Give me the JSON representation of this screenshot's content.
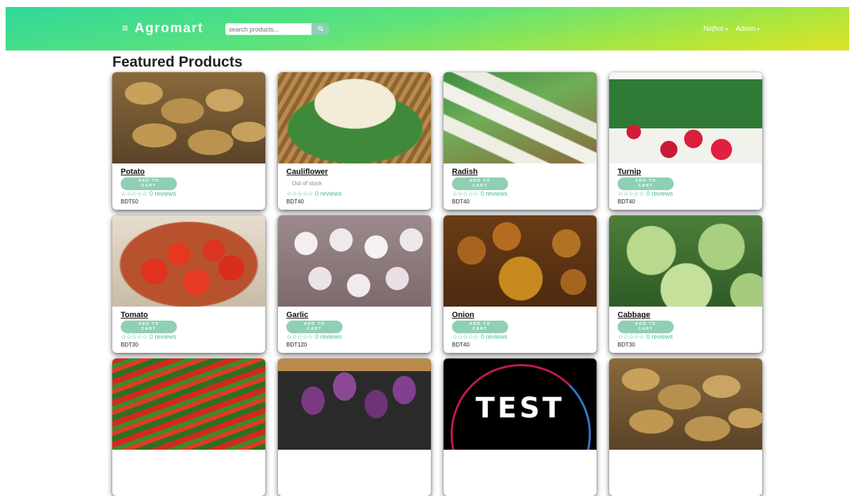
{
  "navbar": {
    "menu_icon": "≡",
    "brand": "Agromart",
    "search_placeholder": "search products...",
    "search_icon": "🔍",
    "user_menu": "Nirjhor",
    "admin_menu": "Admin",
    "caret": "▾"
  },
  "page": {
    "title": "Featured Products"
  },
  "products": [
    {
      "name": "Potato",
      "action": "ADD TO CART",
      "rating": "☆☆☆☆☆",
      "reviews": "0 reviews",
      "price": "BDT50"
    },
    {
      "name": "Cauliflower",
      "action": "Out of stock",
      "rating": "☆☆☆☆☆",
      "reviews": "0 reviews",
      "price": "BDT40"
    },
    {
      "name": "Radish",
      "action": "ADD TO CART",
      "rating": "☆☆☆☆☆",
      "reviews": "0 reviews",
      "price": "BDT40"
    },
    {
      "name": "Turnip",
      "action": "ADD TO CART",
      "rating": "☆☆☆☆☆",
      "reviews": "0 reviews",
      "price": "BDT40"
    },
    {
      "name": "Tomato",
      "action": "ADD TO CART",
      "rating": "☆☆☆☆☆",
      "reviews": "0 reviews",
      "price": "BDT30"
    },
    {
      "name": "Garlic",
      "action": "ADD TO CART",
      "rating": "☆☆☆☆☆",
      "reviews": "0 reviews",
      "price": "BDT120"
    },
    {
      "name": "Onion",
      "action": "ADD TO CART",
      "rating": "☆☆☆☆☆",
      "reviews": "0 reviews",
      "price": "BDT40"
    },
    {
      "name": "Cabbage",
      "action": "ADD TO CART",
      "rating": "☆☆☆☆☆",
      "reviews": "0 reviews",
      "price": "BDT30"
    }
  ],
  "partial_row": {
    "test_logo_text": "TEST"
  },
  "colors": {
    "accent": "#8fd0b2",
    "rating": "#4cbf8b"
  }
}
